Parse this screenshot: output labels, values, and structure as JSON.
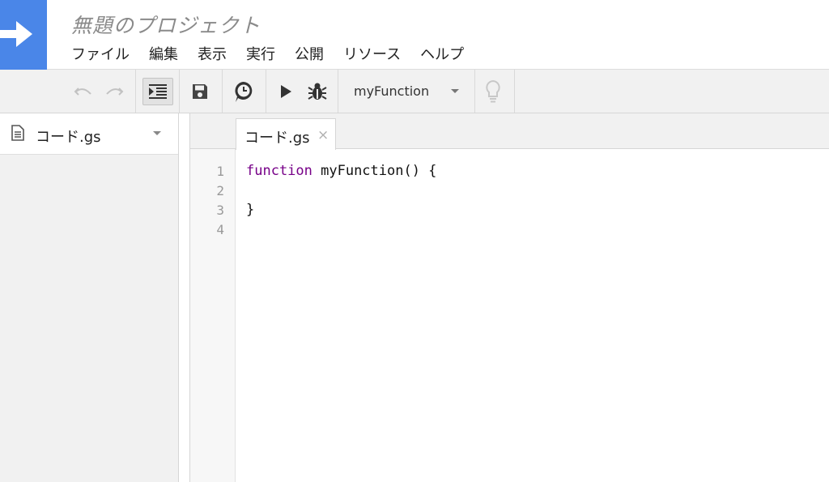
{
  "app": {
    "title": "無題のプロジェクト",
    "logo_icon": "arrow-right-icon",
    "accent_color": "#4a86e8"
  },
  "menu": {
    "items": [
      "ファイル",
      "編集",
      "表示",
      "実行",
      "公開",
      "リソース",
      "ヘルプ"
    ]
  },
  "toolbar": {
    "icons": [
      "undo-icon",
      "redo-icon",
      "indent-icon",
      "save-icon",
      "trigger-clock-icon",
      "run-icon",
      "debug-bug-icon",
      "lightbulb-icon"
    ],
    "function_select": "myFunction"
  },
  "sidebar": {
    "files": [
      {
        "name": "コード.gs",
        "icon": "file-document-icon"
      }
    ]
  },
  "editor": {
    "tab_label": "コード.gs",
    "tab_close": "×",
    "line_numbers": [
      "1",
      "2",
      "3",
      "4"
    ],
    "code": {
      "keyword": "function",
      "line1_rest": " myFunction() {",
      "line2": "",
      "line3": "}",
      "line4": ""
    }
  }
}
